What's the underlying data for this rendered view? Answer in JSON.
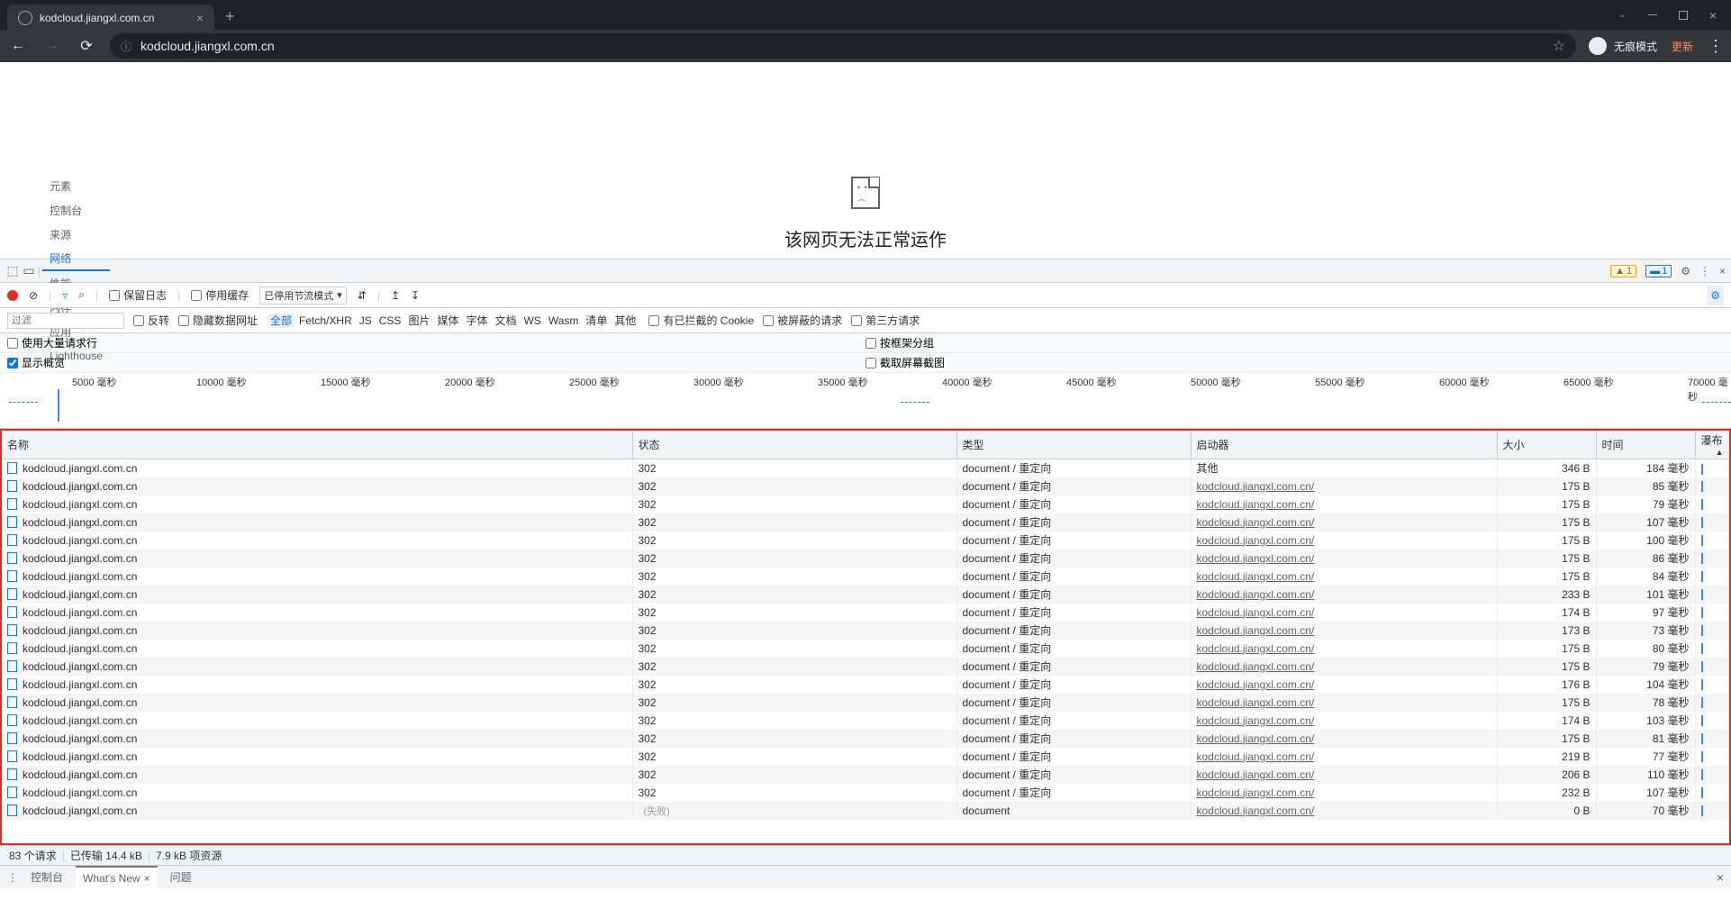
{
  "browser": {
    "tab_title": "kodcloud.jiangxl.com.cn",
    "url_display": "kodcloud.jiangxl.com.cn",
    "incognito_label": "无痕模式",
    "update_label": "更新"
  },
  "page": {
    "error_title": "该网页无法正常运作"
  },
  "devtools": {
    "tabs": [
      "元素",
      "控制台",
      "来源",
      "网络",
      "性能",
      "内存",
      "应用",
      "Lighthouse"
    ],
    "active_tab": "网络",
    "warnings": "1",
    "issues": "1",
    "preserve_log": "保留日志",
    "disable_cache": "停用缓存",
    "throttling": "已停用节流模式",
    "filter_placeholder": "过滤",
    "invert": "反转",
    "hide_data_urls": "隐藏数据网址",
    "filter_types": [
      "全部",
      "Fetch/XHR",
      "JS",
      "CSS",
      "图片",
      "媒体",
      "字体",
      "文档",
      "WS",
      "Wasm",
      "清单",
      "其他"
    ],
    "blocked_cookies": "有已拦截的 Cookie",
    "blocked_requests": "被屏蔽的请求",
    "third_party": "第三方请求",
    "large_rows": "使用大量请求行",
    "group_by_frame": "按框架分组",
    "show_overview": "显示概览",
    "capture_screenshots": "截取屏幕截图"
  },
  "timeline": {
    "ticks": [
      "5000 毫秒",
      "10000 毫秒",
      "15000 毫秒",
      "20000 毫秒",
      "25000 毫秒",
      "30000 毫秒",
      "35000 毫秒",
      "40000 毫秒",
      "45000 毫秒",
      "50000 毫秒",
      "55000 毫秒",
      "60000 毫秒",
      "65000 毫秒",
      "70000 毫秒"
    ]
  },
  "table": {
    "headers": {
      "name": "名称",
      "status": "状态",
      "type": "类型",
      "initiator": "启动器",
      "size": "大小",
      "time": "时间",
      "waterfall": "瀑布"
    },
    "rows": [
      {
        "name": "kodcloud.jiangxl.com.cn",
        "status": "302",
        "type": "document / 重定向",
        "initiator": "其他",
        "size": "346 B",
        "time": "184 毫秒"
      },
      {
        "name": "kodcloud.jiangxl.com.cn",
        "status": "302",
        "type": "document / 重定向",
        "initiator": "kodcloud.jiangxl.com.cn/",
        "size": "175 B",
        "time": "85 毫秒"
      },
      {
        "name": "kodcloud.jiangxl.com.cn",
        "status": "302",
        "type": "document / 重定向",
        "initiator": "kodcloud.jiangxl.com.cn/",
        "size": "175 B",
        "time": "79 毫秒"
      },
      {
        "name": "kodcloud.jiangxl.com.cn",
        "status": "302",
        "type": "document / 重定向",
        "initiator": "kodcloud.jiangxl.com.cn/",
        "size": "175 B",
        "time": "107 毫秒"
      },
      {
        "name": "kodcloud.jiangxl.com.cn",
        "status": "302",
        "type": "document / 重定向",
        "initiator": "kodcloud.jiangxl.com.cn/",
        "size": "175 B",
        "time": "100 毫秒"
      },
      {
        "name": "kodcloud.jiangxl.com.cn",
        "status": "302",
        "type": "document / 重定向",
        "initiator": "kodcloud.jiangxl.com.cn/",
        "size": "175 B",
        "time": "86 毫秒"
      },
      {
        "name": "kodcloud.jiangxl.com.cn",
        "status": "302",
        "type": "document / 重定向",
        "initiator": "kodcloud.jiangxl.com.cn/",
        "size": "175 B",
        "time": "84 毫秒"
      },
      {
        "name": "kodcloud.jiangxl.com.cn",
        "status": "302",
        "type": "document / 重定向",
        "initiator": "kodcloud.jiangxl.com.cn/",
        "size": "233 B",
        "time": "101 毫秒"
      },
      {
        "name": "kodcloud.jiangxl.com.cn",
        "status": "302",
        "type": "document / 重定向",
        "initiator": "kodcloud.jiangxl.com.cn/",
        "size": "174 B",
        "time": "97 毫秒"
      },
      {
        "name": "kodcloud.jiangxl.com.cn",
        "status": "302",
        "type": "document / 重定向",
        "initiator": "kodcloud.jiangxl.com.cn/",
        "size": "173 B",
        "time": "73 毫秒"
      },
      {
        "name": "kodcloud.jiangxl.com.cn",
        "status": "302",
        "type": "document / 重定向",
        "initiator": "kodcloud.jiangxl.com.cn/",
        "size": "175 B",
        "time": "80 毫秒"
      },
      {
        "name": "kodcloud.jiangxl.com.cn",
        "status": "302",
        "type": "document / 重定向",
        "initiator": "kodcloud.jiangxl.com.cn/",
        "size": "175 B",
        "time": "79 毫秒"
      },
      {
        "name": "kodcloud.jiangxl.com.cn",
        "status": "302",
        "type": "document / 重定向",
        "initiator": "kodcloud.jiangxl.com.cn/",
        "size": "176 B",
        "time": "104 毫秒"
      },
      {
        "name": "kodcloud.jiangxl.com.cn",
        "status": "302",
        "type": "document / 重定向",
        "initiator": "kodcloud.jiangxl.com.cn/",
        "size": "175 B",
        "time": "78 毫秒"
      },
      {
        "name": "kodcloud.jiangxl.com.cn",
        "status": "302",
        "type": "document / 重定向",
        "initiator": "kodcloud.jiangxl.com.cn/",
        "size": "174 B",
        "time": "103 毫秒"
      },
      {
        "name": "kodcloud.jiangxl.com.cn",
        "status": "302",
        "type": "document / 重定向",
        "initiator": "kodcloud.jiangxl.com.cn/",
        "size": "175 B",
        "time": "81 毫秒"
      },
      {
        "name": "kodcloud.jiangxl.com.cn",
        "status": "302",
        "type": "document / 重定向",
        "initiator": "kodcloud.jiangxl.com.cn/",
        "size": "219 B",
        "time": "77 毫秒"
      },
      {
        "name": "kodcloud.jiangxl.com.cn",
        "status": "302",
        "type": "document / 重定向",
        "initiator": "kodcloud.jiangxl.com.cn/",
        "size": "206 B",
        "time": "110 毫秒"
      },
      {
        "name": "kodcloud.jiangxl.com.cn",
        "status": "302",
        "type": "document / 重定向",
        "initiator": "kodcloud.jiangxl.com.cn/",
        "size": "232 B",
        "time": "107 毫秒"
      },
      {
        "name": "kodcloud.jiangxl.com.cn",
        "status": "",
        "type": "document",
        "initiator": "kodcloud.jiangxl.com.cn/",
        "size": "0 B",
        "time": "70 毫秒",
        "partial": true
      }
    ],
    "fail_label": "(失败)"
  },
  "status": {
    "requests": "83 个请求",
    "transferred": "已传输 14.4 kB",
    "resources": "7.9 kB 项资源"
  },
  "drawer": {
    "tabs": [
      "控制台",
      "What's New",
      "问题"
    ]
  }
}
